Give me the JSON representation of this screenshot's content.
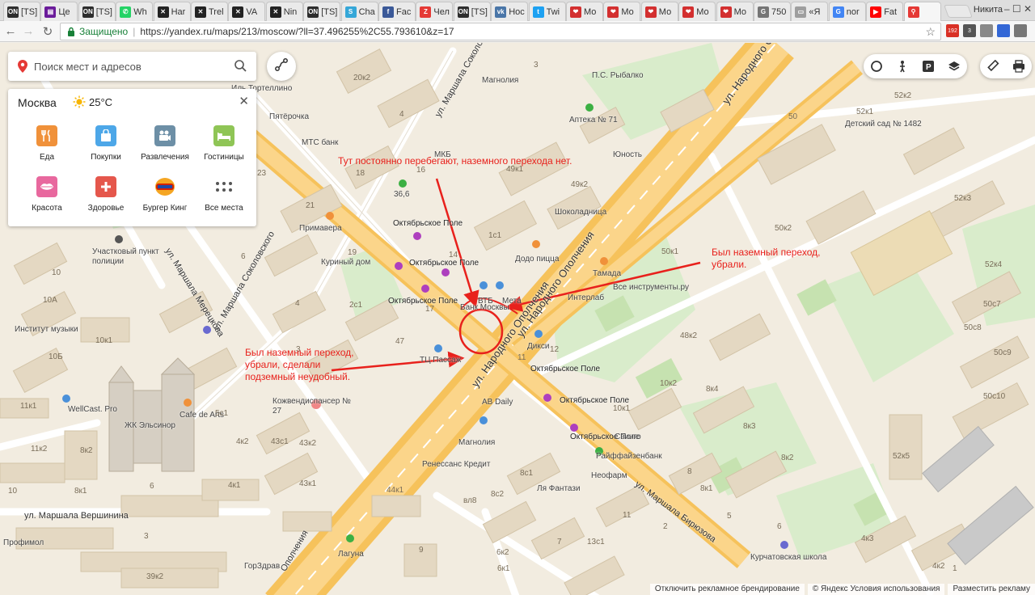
{
  "browser": {
    "tabs": [
      {
        "label": "[TS]",
        "color": "#2d2d2d",
        "glyph": "ON"
      },
      {
        "label": "Це",
        "color": "#6a1b9a",
        "glyph": "▤"
      },
      {
        "label": "[TS]",
        "color": "#2d2d2d",
        "glyph": "ON"
      },
      {
        "label": "Wh",
        "color": "#25d366",
        "glyph": "✆"
      },
      {
        "label": "Har",
        "color": "#222222",
        "glyph": "✕"
      },
      {
        "label": "Trel",
        "color": "#222222",
        "glyph": "✕"
      },
      {
        "label": "VA",
        "color": "#222222",
        "glyph": "✕"
      },
      {
        "label": "Nin",
        "color": "#222222",
        "glyph": "✕"
      },
      {
        "label": "[TS]",
        "color": "#2d2d2d",
        "glyph": "ON"
      },
      {
        "label": "Cha",
        "color": "#35a7d8",
        "glyph": "S"
      },
      {
        "label": "Fac",
        "color": "#3b5998",
        "glyph": "f"
      },
      {
        "label": "Чел",
        "color": "#e53935",
        "glyph": "Z"
      },
      {
        "label": "[TS]",
        "color": "#2d2d2d",
        "glyph": "ON"
      },
      {
        "label": "Нос",
        "color": "#4a76a8",
        "glyph": "vk"
      },
      {
        "label": "Twi",
        "color": "#1da1f2",
        "glyph": "t"
      },
      {
        "label": "Мо",
        "color": "#d32f2f",
        "glyph": "❤"
      },
      {
        "label": "Мо",
        "color": "#d32f2f",
        "glyph": "❤"
      },
      {
        "label": "Мо",
        "color": "#d32f2f",
        "glyph": "❤"
      },
      {
        "label": "Мо",
        "color": "#d32f2f",
        "glyph": "❤"
      },
      {
        "label": "Мо",
        "color": "#d32f2f",
        "glyph": "❤"
      },
      {
        "label": "750",
        "color": "#757575",
        "glyph": "G"
      },
      {
        "label": "«Я",
        "color": "#9e9e9e",
        "glyph": "▭"
      },
      {
        "label": "nor",
        "color": "#4285f4",
        "glyph": "G"
      },
      {
        "label": "Fat",
        "color": "#ff0000",
        "glyph": "▶"
      },
      {
        "label": "",
        "color": "#e53935",
        "glyph": "⚲"
      }
    ],
    "user": "Никита",
    "secure_label": "Защищено",
    "url": "https://yandex.ru/maps/213/moscow/?ll=37.496255%2C55.793610&z=17",
    "extensions": [
      {
        "name": "gmail",
        "badge": "192",
        "color": "#d93025"
      },
      {
        "name": "ext2",
        "badge": "3",
        "color": "#555555"
      },
      {
        "name": "ext3",
        "badge": "",
        "color": "#888888"
      },
      {
        "name": "ext4",
        "badge": "",
        "color": "#3367d6"
      },
      {
        "name": "ext5",
        "badge": "",
        "color": "#777777"
      }
    ]
  },
  "search": {
    "placeholder": "Поиск мест и адресов"
  },
  "categories_panel": {
    "city": "Москва",
    "temperature": "25°C",
    "items": [
      {
        "label": "Еда",
        "color": "#f0913a",
        "icon": "fork-knife-icon"
      },
      {
        "label": "Покупки",
        "color": "#4da7e8",
        "icon": "shopping-bag-icon"
      },
      {
        "label": "Развлечения",
        "color": "#6d8fa6",
        "icon": "film-camera-icon"
      },
      {
        "label": "Гостиницы",
        "color": "#8fc556",
        "icon": "bed-icon"
      },
      {
        "label": "Красота",
        "color": "#e8689e",
        "icon": "lips-icon"
      },
      {
        "label": "Здоровье",
        "color": "#e5574c",
        "icon": "medical-cross-icon"
      },
      {
        "label": "Бургер Кинг",
        "color": "#ffffff",
        "icon": "burger-king-logo"
      },
      {
        "label": "Все места",
        "color": "#ffffff",
        "icon": "grid-dots-icon"
      }
    ]
  },
  "map_labels": {
    "streets": [
      "ул. Маршала Соколовского",
      "ул. Маршала Соколовского",
      "ул. Маршала Мерецкова",
      "ул. Народного Ополчения",
      "ул. Народного Ополчения",
      "ул. Народного Ополчения",
      "ул. Маршала Бирюзова",
      "ул. Маршала Вершинина",
      "Ополчения"
    ],
    "poi": [
      "Иль Тортеллино",
      "Пятёрочка",
      "МТС банк",
      "Магнолия",
      "МКБ",
      "Аптека № 71",
      "Юность",
      "П.С. Рыбалко",
      "Детский сад № 1482",
      "36,6",
      "Шоколадница",
      "Примавера",
      "Куриный дом",
      "Октябрьское Поле",
      "Октябрьское Поле",
      "Октябрьское Поле",
      "Октябрьское Поле",
      "Октябрьское Поле",
      "Октябрьское Поле",
      "Додо пицца",
      "Тамада",
      "Все инструменты.ру",
      "Интерлаб",
      "ВТБ",
      "Мета",
      "Банк Москвы",
      "Дикси",
      "Участковый пункт полиции",
      "Институт музыки",
      "Кожвендиспансер № 27",
      "WellCast. Pro",
      "Cafe de Arts",
      "ЖК Эльсинор",
      "ТЦ Пассаж",
      "AB Daily",
      "Магнолия",
      "Свинго",
      "Ренессанс Кредит",
      "Райффайзенбанк",
      "Неофарм",
      "Ля Фантази",
      "Профимол",
      "ГорЗдрав",
      "Лагуна",
      "Курчатовская школа"
    ],
    "house_numbers": [
      "20к2",
      "4",
      "3",
      "16",
      "18",
      "17",
      "49к1",
      "49к2",
      "1с1",
      "21",
      "6",
      "19",
      "14",
      "23",
      "10",
      "10А",
      "10Б",
      "10к1",
      "4",
      "2с1",
      "3",
      "47",
      "12",
      "11",
      "50",
      "52к1",
      "52к2",
      "52к3",
      "50к1",
      "50к2",
      "52к4",
      "50с7",
      "50с8",
      "50с9",
      "50с10",
      "48к2",
      "8к4",
      "8к3",
      "8к2",
      "8к1",
      "10к2",
      "10к1",
      "8",
      "11к1",
      "11к2",
      "8к2",
      "8к1",
      "10",
      "5с1",
      "4к2",
      "43с1",
      "43к2",
      "43к1",
      "4к1",
      "6",
      "3",
      "39к2",
      "44к1",
      "8с1",
      "8с2",
      "вл8",
      "13с1",
      "11",
      "7",
      "9",
      "6к2",
      "6к1",
      "4к3",
      "4к2",
      "52к5",
      "6",
      "5",
      "2",
      "1"
    ]
  },
  "annotations": [
    {
      "text": "Тут постоянно перебегают, наземного перехода нет."
    },
    {
      "text": "Был  наземный переход, убрали."
    },
    {
      "text": "Был наземный переход, убрали, сделали подземный неудобный."
    }
  ],
  "footer": {
    "disable_ads": "Отключить рекламное брендирование",
    "copyright": "© Яндекс",
    "terms": "Условия использования",
    "advertise": "Разместить рекламу"
  }
}
